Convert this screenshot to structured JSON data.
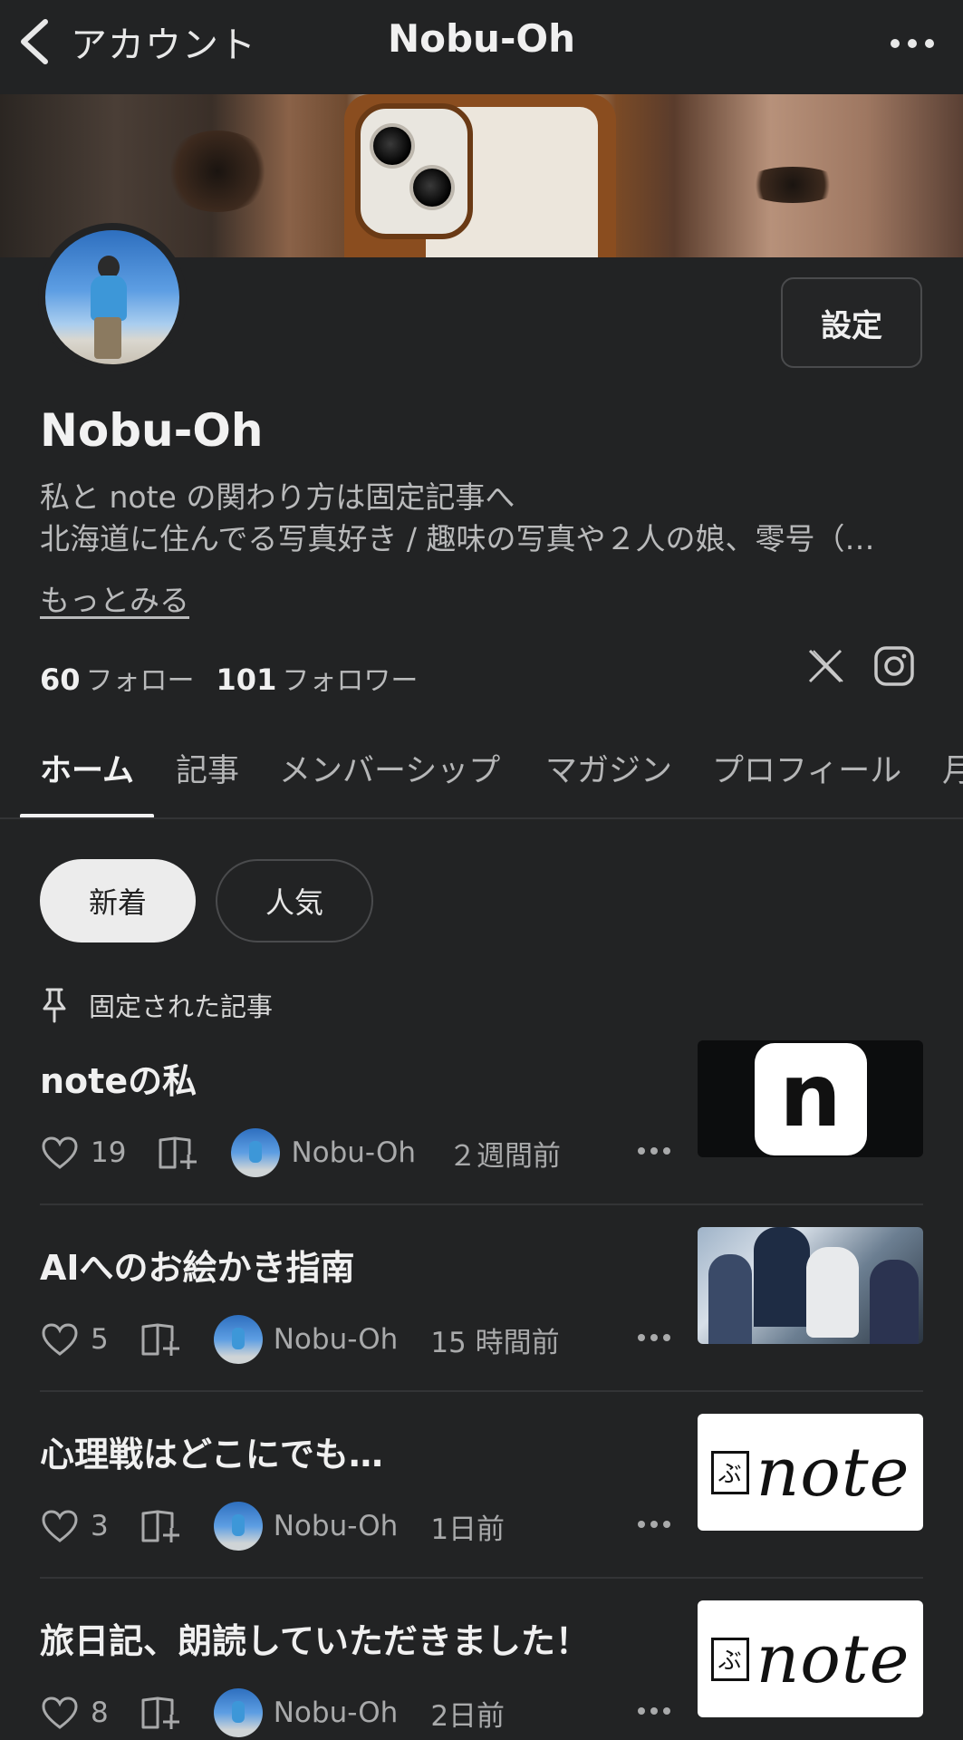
{
  "header": {
    "back_label": "アカウント",
    "title": "Nobu-Oh",
    "back_icon": "chevron-left-icon",
    "more_icon": "ellipsis-icon"
  },
  "profile": {
    "settings_label": "設定",
    "name": "Nobu-Oh",
    "bio_line1": "私と note の関わり方は固定記事へ",
    "bio_line2": "北海道に住んでる写真好き / 趣味の写真や２人の娘、零号（…",
    "more_link": "もっとみる",
    "follow_count": "60",
    "follow_label": "フォロー",
    "follower_count": "101",
    "follower_label": "フォロワー",
    "social_icons": [
      "x-icon",
      "instagram-icon"
    ]
  },
  "tabs": [
    {
      "label": "ホーム",
      "active": true
    },
    {
      "label": "記事",
      "active": false
    },
    {
      "label": "メンバーシップ",
      "active": false
    },
    {
      "label": "マガジン",
      "active": false
    },
    {
      "label": "プロフィール",
      "active": false
    },
    {
      "label": "月",
      "active": false
    }
  ],
  "sort": {
    "new_label": "新着",
    "popular_label": "人気"
  },
  "pinned_label": "固定された記事",
  "articles": [
    {
      "title": "noteの私",
      "likes": "19",
      "author": "Nobu-Oh",
      "time": "２週間前",
      "thumb_letter": "n"
    },
    {
      "title": "AIへのお絵かき指南",
      "likes": "5",
      "author": "Nobu-Oh",
      "time": "15 時間前"
    },
    {
      "title": "心理戦はどこにでも…",
      "likes": "3",
      "author": "Nobu-Oh",
      "time": "1日前",
      "thumb_mark": "ぶ",
      "thumb_word": "note"
    },
    {
      "title": "旅日記、朗読していただきました！",
      "likes": "8",
      "author": "Nobu-Oh",
      "time": "2日前",
      "thumb_mark": "ぶ",
      "thumb_word": "note"
    }
  ],
  "colors": {
    "background": "#222324",
    "text_primary": "#f0f0f0",
    "text_secondary": "#b9babb",
    "pill_active": "#ececec"
  }
}
